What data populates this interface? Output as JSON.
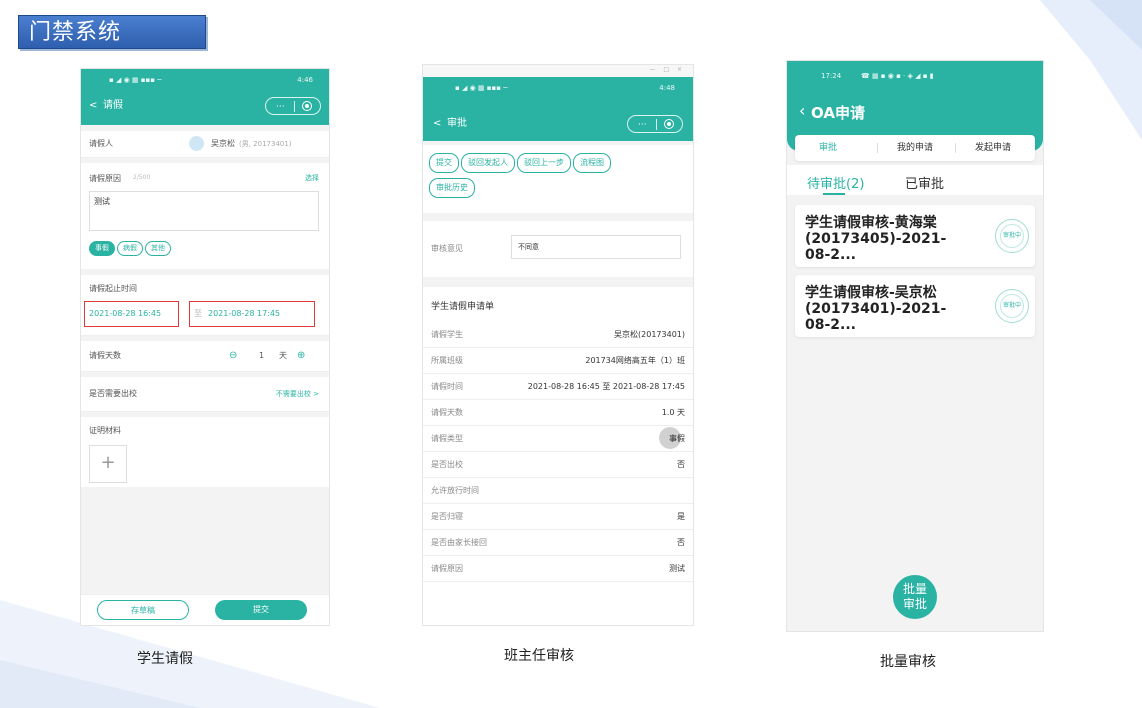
{
  "page_title": "门禁系统",
  "captions": [
    "学生请假",
    "班主任审核",
    "批量审核"
  ],
  "colors": {
    "teal": "#2ab3a3",
    "red": "#e03a3a",
    "title_blue": "#3a6cbf"
  },
  "phone1": {
    "status_time": "4:46",
    "nav_back": "<",
    "nav_title": "请假",
    "capsule_dots": "···",
    "applicant_label": "请假人",
    "applicant_name": "吴京松",
    "applicant_extra": "(男, 20173401)",
    "reason_label": "请假原因",
    "reason_counter": "2/500",
    "reason_select": "选择",
    "reason_text": "测试",
    "type_pills": [
      "事假",
      "病假",
      "其他"
    ],
    "period_label": "请假起止时间",
    "start_time": "2021-08-28 16:45",
    "end_prefix": "至",
    "end_time": "2021-08-28 17:45",
    "days_label": "请假天数",
    "days_minus": "⊖",
    "days_value": "1",
    "days_unit": "天",
    "days_plus": "⊕",
    "leave_school_label": "是否需要出校",
    "leave_school_value": "不需要出校 >",
    "proof_label": "证明材料",
    "proof_add": "+",
    "btn_draft": "存草稿",
    "btn_submit": "提交"
  },
  "phone2": {
    "window_controls": "— □ ×",
    "status_time": "4:48",
    "nav_back": "<",
    "nav_title": "审批",
    "capsule_dots": "···",
    "actions": [
      "提交",
      "驳回发起人",
      "驳回上一步",
      "流程图",
      "审批历史"
    ],
    "opinion_label": "审核意见",
    "opinion_value": "不同意",
    "section_title": "学生请假申请单",
    "rows": [
      {
        "k": "请假学生",
        "v": "吴京松(20173401)"
      },
      {
        "k": "所属班级",
        "v": "201734网络高五年（1）班"
      },
      {
        "k": "请假时间",
        "v": "2021-08-28 16:45 至 2021-08-28 17:45"
      },
      {
        "k": "请假天数",
        "v": "1.0 天"
      },
      {
        "k": "请假类型",
        "v": "事假"
      },
      {
        "k": "是否出校",
        "v": "否"
      },
      {
        "k": "允许放行时间",
        "v": ""
      },
      {
        "k": "是否归寝",
        "v": "是"
      },
      {
        "k": "是否由家长接回",
        "v": "否"
      },
      {
        "k": "请假原因",
        "v": "测试"
      }
    ]
  },
  "phone3": {
    "status_time": "17:24",
    "nav_back": "‹",
    "nav_title": "OA申请",
    "tabs": [
      "审批",
      "我的申请",
      "发起申请"
    ],
    "subtabs": [
      "待审批(2)",
      "已审批"
    ],
    "cards": [
      {
        "title": "学生请假审核-黄海棠(20173405)-2021-08-2...",
        "stamp": "审批中"
      },
      {
        "title": "学生请假审核-吴京松(20173401)-2021-08-2...",
        "stamp": "审批中"
      }
    ],
    "fab": "批量审批"
  }
}
